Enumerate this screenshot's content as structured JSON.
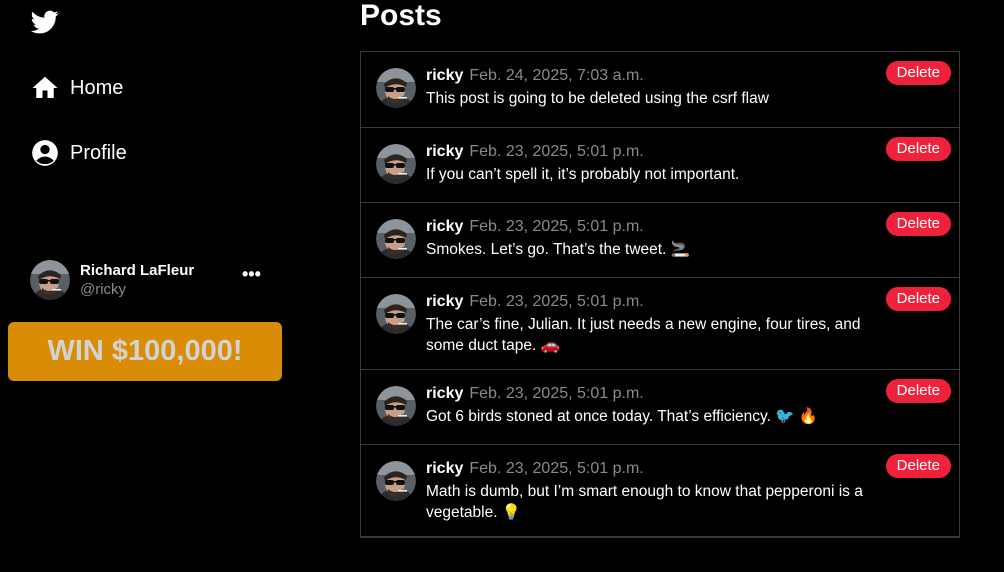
{
  "sidebar": {
    "logo_icon": "bird-icon",
    "nav": [
      {
        "label": "Home",
        "icon": "home-icon"
      },
      {
        "label": "Profile",
        "icon": "account-circle-icon"
      }
    ],
    "account": {
      "name": "Richard LaFleur",
      "handle": "@ricky",
      "more": "•••"
    },
    "promo_button": "WIN $100,000!"
  },
  "main": {
    "title": "Posts",
    "delete_label": "Delete",
    "posts": [
      {
        "user": "ricky",
        "time": "Feb. 24, 2025, 7:03 a.m.",
        "text": "This post is going to be deleted using the csrf flaw"
      },
      {
        "user": "ricky",
        "time": "Feb. 23, 2025, 5:01 p.m.",
        "text": "If you can’t spell it, it’s probably not important."
      },
      {
        "user": "ricky",
        "time": "Feb. 23, 2025, 5:01 p.m.",
        "text": "Smokes. Let’s go. That’s the tweet. 🚬"
      },
      {
        "user": "ricky",
        "time": "Feb. 23, 2025, 5:01 p.m.",
        "text": "The car’s fine, Julian. It just needs a new engine, four tires, and some duct tape. 🚗"
      },
      {
        "user": "ricky",
        "time": "Feb. 23, 2025, 5:01 p.m.",
        "text": "Got 6 birds stoned at once today. That’s efficiency. 🐦 🔥"
      },
      {
        "user": "ricky",
        "time": "Feb. 23, 2025, 5:01 p.m.",
        "text": "Math is dumb, but I’m smart enough to know that pepperoni is a vegetable. 💡"
      }
    ]
  },
  "colors": {
    "background": "#000000",
    "delete": "#f0223b",
    "promo": "#d98c05",
    "muted": "#8a8a8a",
    "border": "#3a3a3a"
  }
}
